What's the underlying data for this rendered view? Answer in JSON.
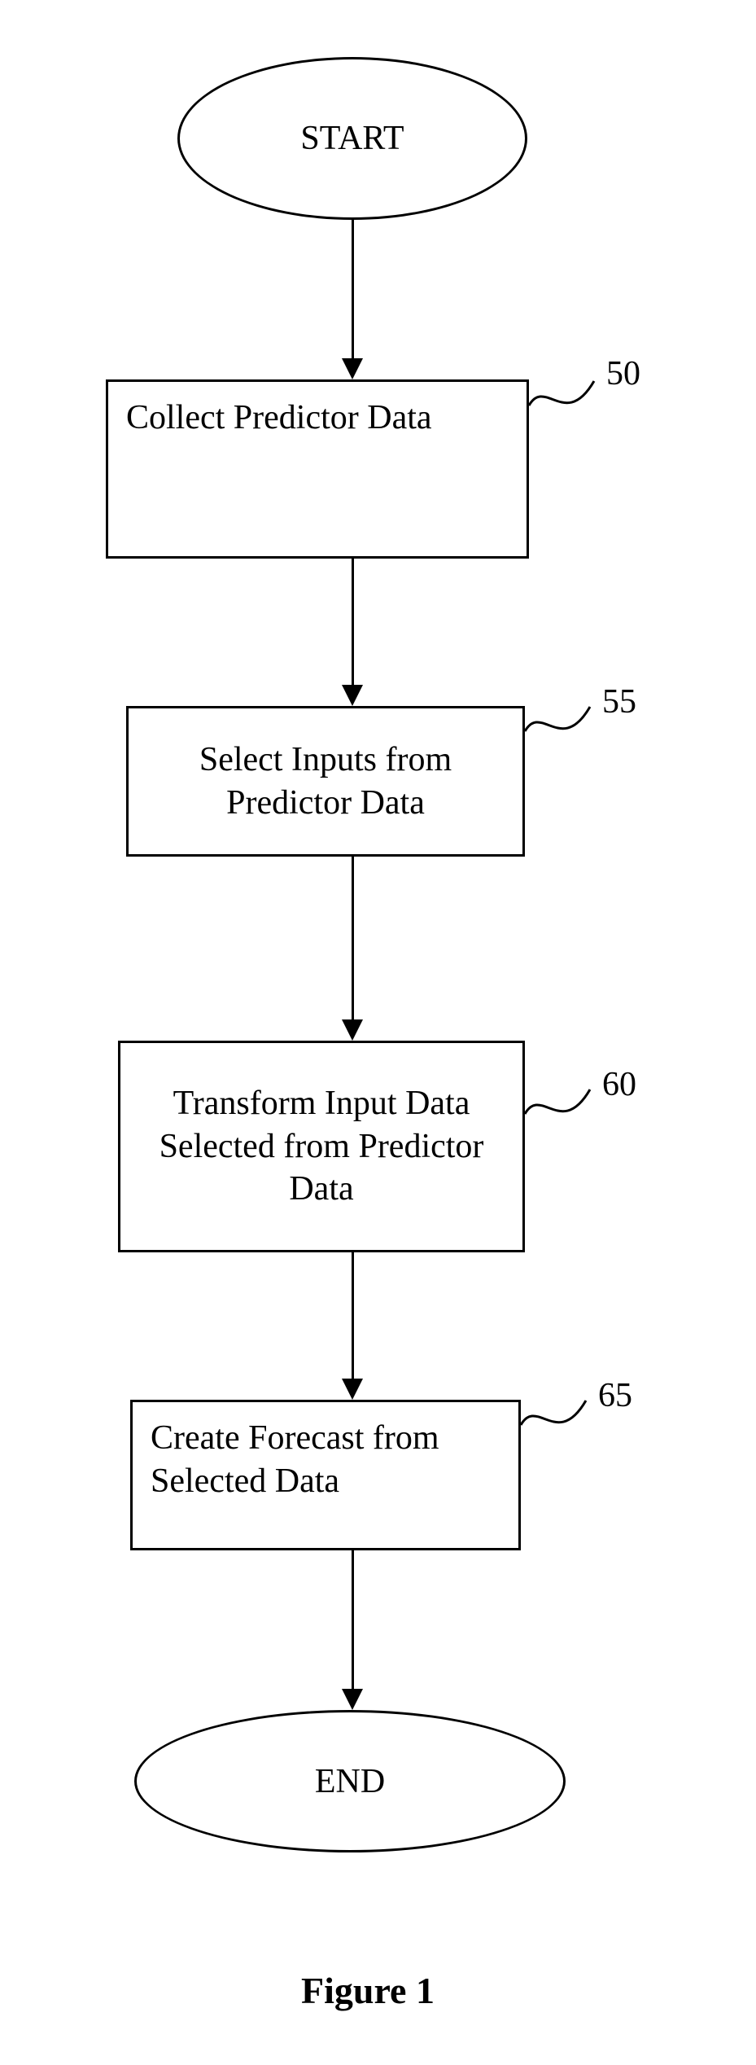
{
  "flow": {
    "start": "START",
    "end": "END",
    "steps": {
      "s50": {
        "text": "Collect Predictor Data",
        "num": "50"
      },
      "s55": {
        "text": "Select Inputs from Predictor Data",
        "num": "55"
      },
      "s60": {
        "text": "Transform Input Data Selected from Predictor Data",
        "num": "60"
      },
      "s65": {
        "text": "Create Forecast from Selected Data",
        "num": "65"
      }
    }
  },
  "caption": "Figure 1"
}
